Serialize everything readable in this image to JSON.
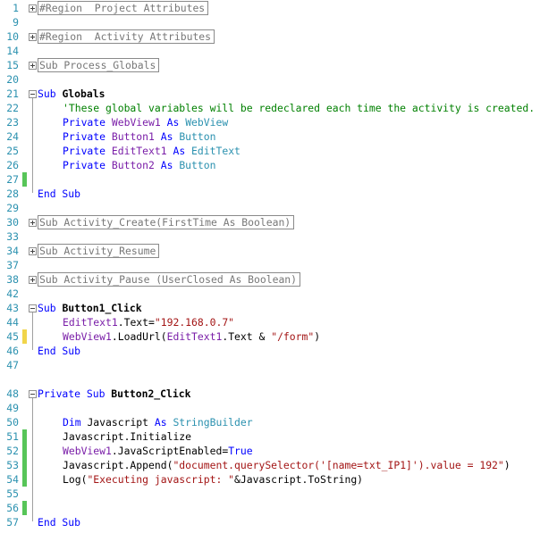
{
  "editor": {
    "lines": [
      {
        "no": "1",
        "fold": "plus",
        "collapsed": "#Region  Project Attributes"
      },
      {
        "no": "9"
      },
      {
        "no": "10",
        "fold": "plus",
        "collapsed": "#Region  Activity Attributes"
      },
      {
        "no": "14"
      },
      {
        "no": "15",
        "fold": "plus",
        "collapsed": "Sub Process_Globals"
      },
      {
        "no": "20"
      },
      {
        "no": "21",
        "fold": "minus",
        "kw": "Sub ",
        "name": "Globals"
      },
      {
        "no": "22",
        "comment": "'These global variables will be redeclared each time the activity is created."
      },
      {
        "no": "23",
        "decl": {
          "kw": "Private ",
          "var": "WebView1",
          "as": " As ",
          "type": "WebView"
        }
      },
      {
        "no": "24",
        "decl": {
          "kw": "Private ",
          "var": "Button1",
          "as": " As ",
          "type": "Button"
        }
      },
      {
        "no": "25",
        "decl": {
          "kw": "Private ",
          "var": "EditText1",
          "as": " As ",
          "type": "EditText"
        }
      },
      {
        "no": "26",
        "decl": {
          "kw": "Private ",
          "var": "Button2",
          "as": " As ",
          "type": "Button"
        }
      },
      {
        "no": "27",
        "marker": "green"
      },
      {
        "no": "28",
        "end": "End Sub"
      },
      {
        "no": "29"
      },
      {
        "no": "30",
        "fold": "plus",
        "collapsed": "Sub Activity_Create(FirstTime As Boolean)"
      },
      {
        "no": "33"
      },
      {
        "no": "34",
        "fold": "plus",
        "collapsed": "Sub Activity_Resume"
      },
      {
        "no": "37"
      },
      {
        "no": "38",
        "fold": "plus",
        "collapsed": "Sub Activity_Pause (UserClosed As Boolean)"
      },
      {
        "no": "42"
      },
      {
        "no": "43",
        "fold": "minus",
        "kw": "Sub ",
        "name": "Button1_Click"
      },
      {
        "no": "44"
      },
      {
        "no": "45",
        "marker": "yellow"
      },
      {
        "no": "46",
        "end": "End Sub"
      },
      {
        "no": "47"
      },
      {
        "no": "48",
        "fold": "minus",
        "kw": "Private Sub ",
        "name": "Button2_Click"
      },
      {
        "no": "49"
      },
      {
        "no": "50"
      },
      {
        "no": "51",
        "marker": "green"
      },
      {
        "no": "52",
        "marker": "green"
      },
      {
        "no": "53",
        "marker": "green"
      },
      {
        "no": "54",
        "marker": "green"
      },
      {
        "no": "55"
      },
      {
        "no": "56",
        "marker": "green"
      },
      {
        "no": "57",
        "end": "End Sub"
      }
    ],
    "button1_body": {
      "line43": {
        "obj": "EditText1",
        "member": ".Text=",
        "value": "\"192.168.0.7\""
      },
      "line44": {
        "obj": "WebView1",
        "member": ".LoadUrl(",
        "arg1": "EditText1",
        "arg1b": ".Text & ",
        "value": "\"/form\"",
        "close": ")"
      }
    },
    "button2_body": {
      "dim": {
        "kw": "Dim ",
        "var": "Javascript",
        "as": " As ",
        "type": "StringBuilder"
      },
      "init": "Javascript.Initialize",
      "js_enabled": {
        "obj": "WebView1",
        "member": ".JavaScriptEnabled=",
        "value": "True"
      },
      "append": {
        "prefix": "Javascript.Append(",
        "value": "\"document.querySelector('[name=txt_IP1]').value = 192\"",
        "close": ")"
      },
      "log": {
        "prefix": "Log(",
        "value": "\"Executing javascript: \"",
        "rest": "&Javascript.ToString)"
      }
    }
  }
}
